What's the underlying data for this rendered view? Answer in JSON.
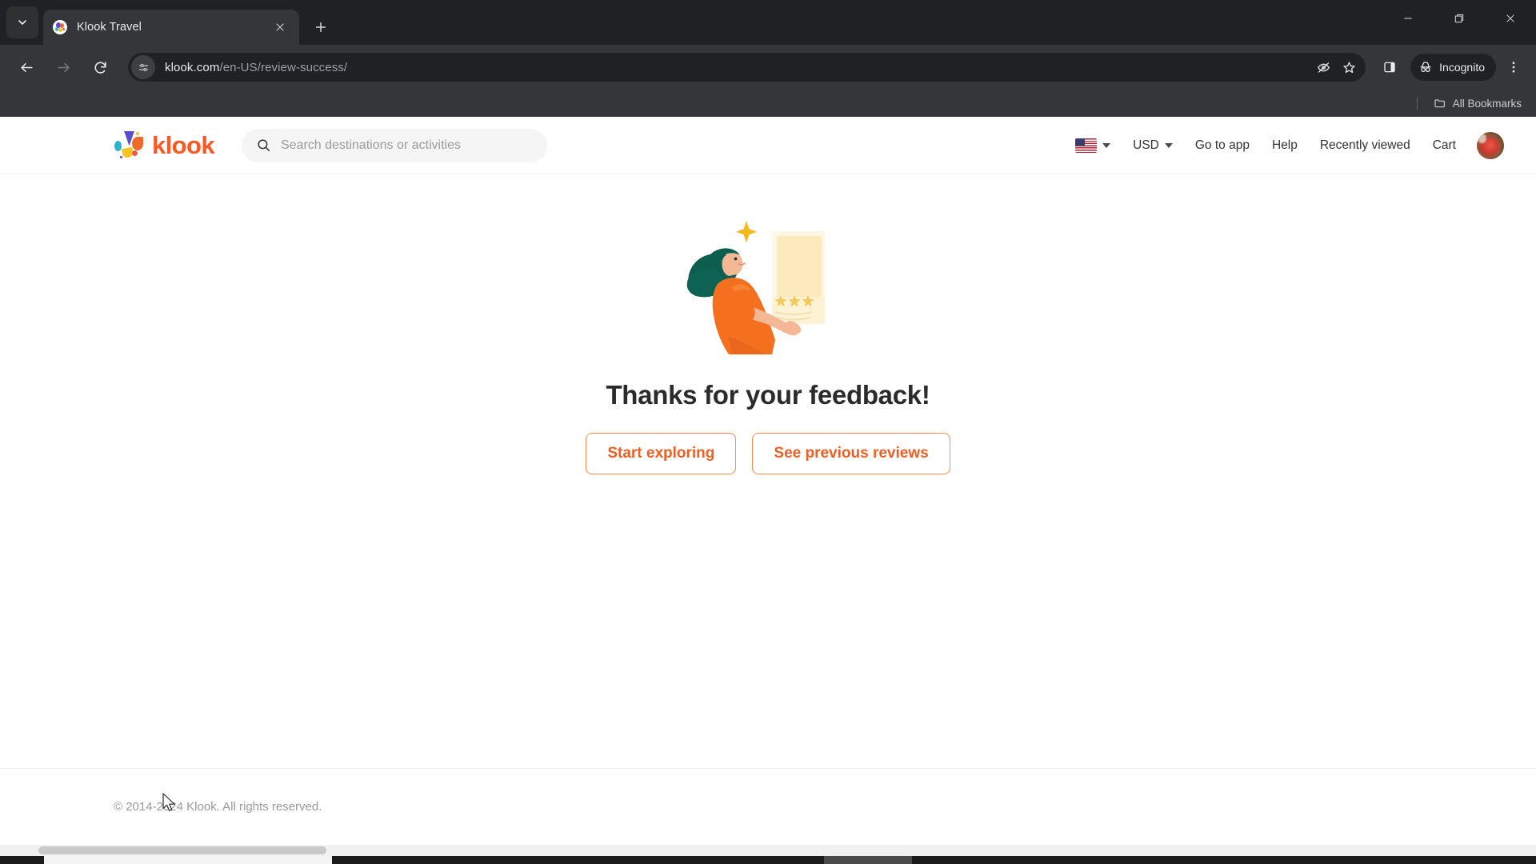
{
  "browser": {
    "tab_search_icon": "chevron-down-icon",
    "tab": {
      "title": "Klook Travel",
      "favicon": "klook-favicon",
      "close_icon": "close-icon"
    },
    "new_tab_icon": "plus-icon",
    "window_controls": {
      "minimize": "minimize-icon",
      "maximize": "restore-icon",
      "close": "close-icon"
    },
    "nav": {
      "back_icon": "arrow-left-icon",
      "forward_icon": "arrow-right-icon",
      "reload_icon": "reload-icon"
    },
    "omnibox": {
      "site_settings_icon": "tune-icon",
      "url_host": "klook.com",
      "url_path": "/en-US/review-success/",
      "tracking_protection_icon": "eye-slash-icon",
      "bookmark_icon": "star-icon"
    },
    "toolbar": {
      "side_panel_icon": "side-panel-icon",
      "incognito_label": "Incognito",
      "incognito_icon": "incognito-icon",
      "menu_icon": "three-dot-menu-icon"
    },
    "bookmarks_bar": {
      "all_bookmarks_label": "All Bookmarks",
      "folder_icon": "folder-icon"
    }
  },
  "site": {
    "logo": {
      "text": "klook",
      "mark": "klook-logo-mark",
      "color": "#ff5722"
    },
    "search": {
      "placeholder": "Search destinations or activities",
      "value": "",
      "icon": "search-icon"
    },
    "header_nav": {
      "language": {
        "flag": "us-flag-icon",
        "caret": "chevron-down-icon"
      },
      "currency": {
        "label": "USD",
        "caret": "chevron-down-icon"
      },
      "items": [
        {
          "label": "Go to app"
        },
        {
          "label": "Help"
        },
        {
          "label": "Recently viewed"
        },
        {
          "label": "Cart"
        }
      ],
      "avatar": "user-avatar"
    },
    "main": {
      "illustration": "review-thanks-illustration",
      "headline": "Thanks for your feedback!",
      "buttons": [
        {
          "label": "Start exploring",
          "name": "start-exploring-button"
        },
        {
          "label": "See previous reviews",
          "name": "see-previous-reviews-button"
        }
      ]
    },
    "footer": {
      "copyright": "© 2014-2024 Klook. All rights reserved."
    }
  },
  "colors": {
    "brand_orange": "#ff5722",
    "cta_text": "#f05e23",
    "cta_border": "#ff8a4c",
    "chrome_dark": "#202124",
    "chrome_toolbar": "#35363a"
  }
}
